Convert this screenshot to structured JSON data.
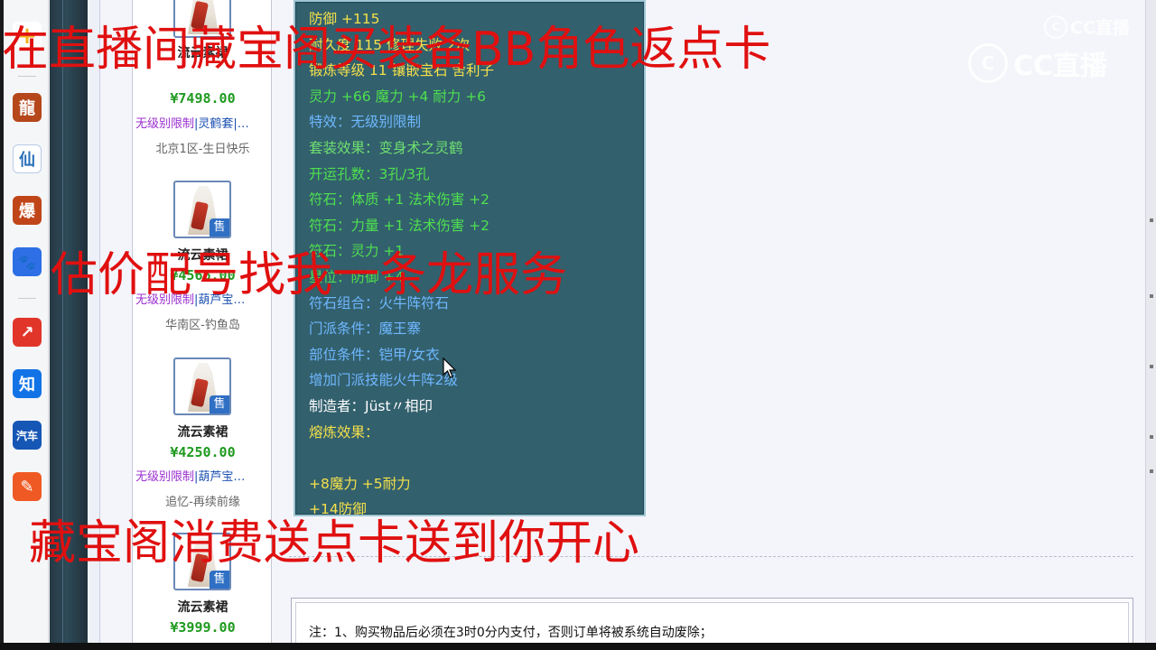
{
  "app_sidebar": {
    "icons": [
      {
        "name": "add-icon",
        "glyph": "+",
        "color": "#f2b21b"
      },
      {
        "name": "game-emblem-icon",
        "glyph": "龍",
        "color": "#b5471b"
      },
      {
        "name": "xian-game-icon",
        "glyph": "仙",
        "color": "#2a6fb8"
      },
      {
        "name": "bao-game-icon",
        "glyph": "爆",
        "color": "#c0461a"
      },
      {
        "name": "baidu-paw-icon",
        "glyph": "🐾",
        "color": "#2e6fe6"
      },
      {
        "name": "video-app-icon",
        "glyph": "↗",
        "color": "#e1352a"
      },
      {
        "name": "zhihu-icon",
        "glyph": "知",
        "color": "#1273e6"
      },
      {
        "name": "car-app-icon",
        "glyph": "汽车",
        "color": "#1656b5"
      },
      {
        "name": "news-app-icon",
        "glyph": "✎",
        "color": "#ef5a24"
      }
    ]
  },
  "products": [
    {
      "name": "流云素裙",
      "price": "¥7498.00",
      "tag1": "无级别限制",
      "tag2": "|灵鹤套|…",
      "server": "北京1区-生日快乐"
    },
    {
      "name": "流云素裙",
      "price": "¥4566.00",
      "tag1": "无级别限制",
      "tag2": "|葫芦宝…",
      "server": "华南区-钓鱼岛",
      "badge": "售"
    },
    {
      "name": "流云素裙",
      "price": "¥4250.00",
      "tag1": "无级别限制",
      "tag2": "|葫芦宝…",
      "server": "追忆-再续前缘",
      "badge": "售"
    },
    {
      "name": "流云素裙",
      "price": "¥3999.00",
      "badge": "售"
    }
  ],
  "tooltip": {
    "lines": [
      {
        "text": "防御 +115",
        "color": "#f4e04a"
      },
      {
        "text": "耐久度 115  修理失败 2次",
        "color": "#f4e04a"
      },
      {
        "text": "锻炼等级 11  镶嵌宝石 舍利子",
        "color": "#f4e04a"
      },
      {
        "text": "灵力 +66  魔力 +4  耐力 +6",
        "color": "#4fe04f"
      },
      {
        "text": "特效：无级别限制",
        "color": "#6fb7ff"
      },
      {
        "text": "套装效果：变身术之灵鹤",
        "color": "#6fe06f"
      },
      {
        "text": "开运孔数：3孔/3孔",
        "color": "#4fe04f"
      },
      {
        "text": "符石：体质 +1  法术伤害 +2",
        "color": "#4fe04f"
      },
      {
        "text": "符石：力量 +1  法术伤害 +2",
        "color": "#4fe04f"
      },
      {
        "text": "符石：灵力 +1",
        "color": "#4fe04f"
      },
      {
        "text": "星位：防御 +4",
        "color": "#4fe04f"
      },
      {
        "text": "符石组合：火牛阵符石",
        "color": "#6fb7ff"
      },
      {
        "text": "门派条件：魔王寨",
        "color": "#6fb7ff"
      },
      {
        "text": "部位条件：铠甲/女衣",
        "color": "#6fb7ff"
      },
      {
        "text": "增加门派技能火牛阵2级",
        "color": "#6fb7ff"
      },
      {
        "text": "制造者：Jüst〃相印",
        "color": "#ffffff"
      },
      {
        "text": "熔炼效果：",
        "color": "#f4e04a"
      },
      {
        "text": "",
        "color": "#f4e04a"
      },
      {
        "text": "+8魔力 +5耐力",
        "color": "#f4e04a"
      },
      {
        "text": "+14防御",
        "color": "#f4e04a"
      }
    ]
  },
  "notes": {
    "text": "注：1、购买物品后必须在3时0分内支付，否则订单将被系统自动废除；"
  },
  "watermark": {
    "small": "CC直播",
    "large": "CC直播"
  },
  "overlay": {
    "line1": "在直播间藏宝阁买装备BB角色返点卡",
    "line2": "估价配号找我一条龙服务",
    "line3": "藏宝阁消费送点卡送到你开心"
  }
}
